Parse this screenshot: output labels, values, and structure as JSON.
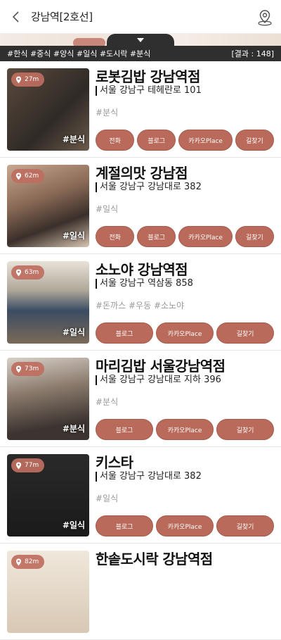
{
  "header": {
    "title": "강남역[2호선]"
  },
  "filter": {
    "tags": "#한식 #중식 #양식 #일식 #도시락 #분식",
    "result": "[결과 : 148]"
  },
  "colors": {
    "accent": "#b96a5a",
    "bar": "#2f2f2f"
  },
  "restaurants": [
    {
      "distance": "27m",
      "name": "로봇김밥 강남역점",
      "address": "서울 강남구 테헤란로 101",
      "tags": "#분식",
      "category": "#분식",
      "buttons": [
        "전화",
        "블로그",
        "카카오Place",
        "길찾기"
      ]
    },
    {
      "distance": "62m",
      "name": "계절의맛 강남점",
      "address": "서울 강남구 강남대로 382",
      "tags": "#일식",
      "category": "#일식",
      "buttons": [
        "전화",
        "블로그",
        "카카오Place",
        "길찾기"
      ]
    },
    {
      "distance": "63m",
      "name": "소노야 강남역점",
      "address": "서울 강남구 역삼동 858",
      "tags": "#돈까스 #우동 #소노야",
      "category": "#일식",
      "buttons": [
        "블로그",
        "카카오Place",
        "길찾기"
      ]
    },
    {
      "distance": "73m",
      "name": "마리김밥 서울강남역점",
      "address": "서울 강남구 강남대로 지하 396",
      "tags": "#분식",
      "category": "#분식",
      "buttons": [
        "블로그",
        "카카오Place",
        "길찾기"
      ]
    },
    {
      "distance": "77m",
      "name": "키스타",
      "address": "서울 강남구 강남대로 382",
      "tags": "#일식",
      "category": "#일식",
      "buttons": [
        "블로그",
        "카카오Place",
        "길찾기"
      ]
    },
    {
      "distance": "82m",
      "name": "한솥도시락 강남역점",
      "address": "",
      "tags": "",
      "category": "",
      "buttons": []
    }
  ]
}
